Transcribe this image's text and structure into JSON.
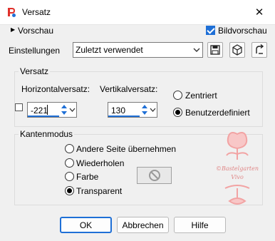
{
  "window": {
    "title": "Versatz",
    "close_glyph": "✕"
  },
  "preview": {
    "label": "Vorschau",
    "chevron": "▶"
  },
  "image_preview": {
    "label": "Bildvorschau",
    "checked": true
  },
  "settings": {
    "label": "Einstellungen",
    "value": "Zuletzt verwendet"
  },
  "offset_group": {
    "title": "Versatz",
    "horizontal": {
      "label": "Horizontalversatz:",
      "value": "-221"
    },
    "vertical": {
      "label": "Vertikalversatz:",
      "value": "130"
    },
    "centered": {
      "label": "Zentriert",
      "selected": false
    },
    "custom": {
      "label": "Benutzerdefiniert",
      "selected": true
    }
  },
  "edge_group": {
    "title": "Kantenmodus",
    "options": [
      {
        "label": "Andere Seite übernehmen",
        "selected": false
      },
      {
        "label": "Wiederholen",
        "selected": false
      },
      {
        "label": "Farbe",
        "selected": false
      },
      {
        "label": "Transparent",
        "selected": true
      }
    ]
  },
  "buttons": {
    "ok": "OK",
    "cancel": "Abbrechen",
    "help": "Hilfe"
  },
  "colors": {
    "accent": "#1e6fd6",
    "watermark": "#f2a3a3"
  },
  "watermark": {
    "text_lines": [
      "©Bastelgarten",
      "Vivo"
    ]
  }
}
